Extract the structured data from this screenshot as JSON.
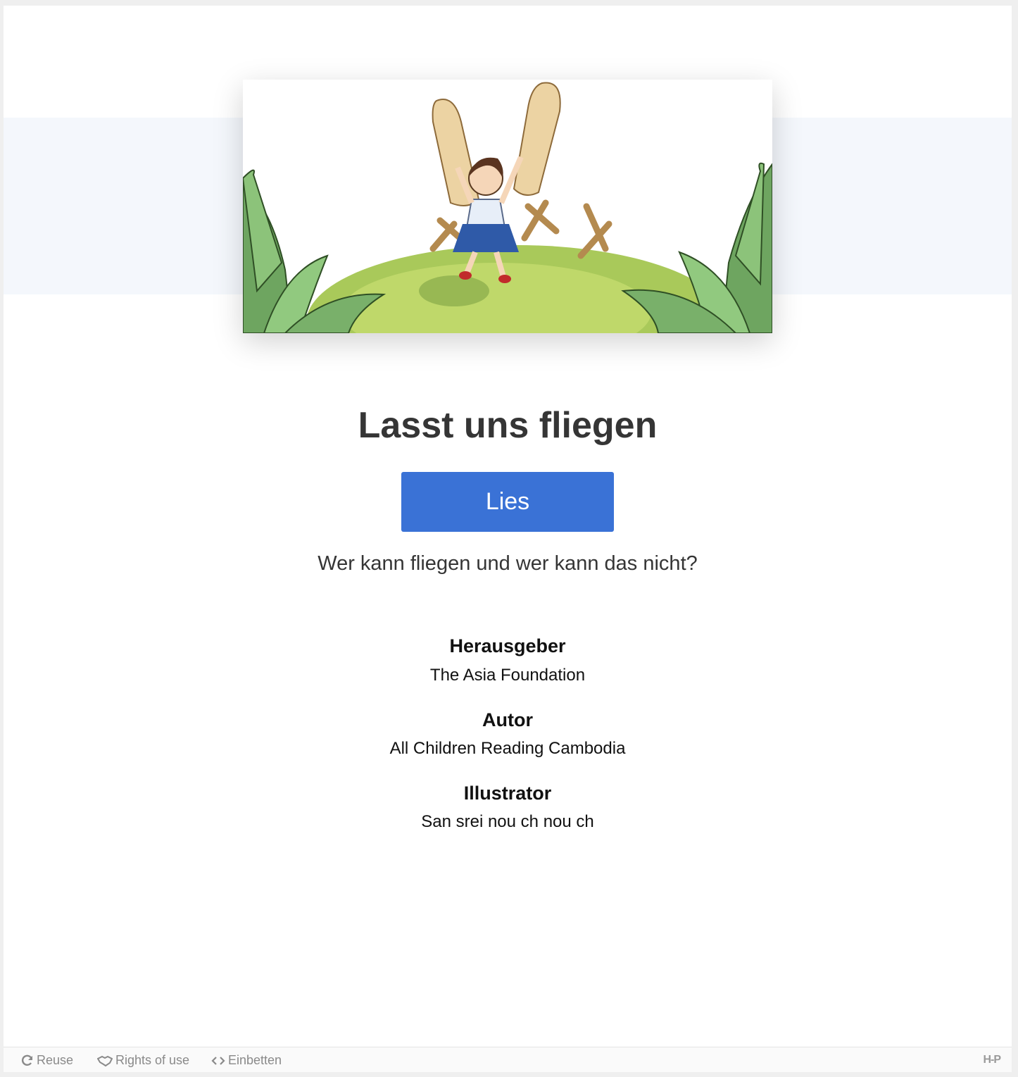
{
  "book": {
    "cover_alt": "Girl with wing-shaped boards jumping on a grassy hill",
    "title": "Lasst uns fliegen",
    "read_button": "Lies",
    "description": "Wer kann fliegen und wer kann das nicht?"
  },
  "credits": [
    {
      "label": "Herausgeber",
      "value": "The Asia Foundation"
    },
    {
      "label": "Autor",
      "value": "All Children Reading Cambodia"
    },
    {
      "label": "Illustrator",
      "value": "San srei nou ch nou ch"
    }
  ],
  "footer": {
    "reuse": "Reuse",
    "rights": "Rights of use",
    "embed": "Einbetten",
    "logo": "H-P"
  },
  "colors": {
    "accent": "#3a72d6",
    "band": "#f4f7fc",
    "title_text": "#353535"
  }
}
